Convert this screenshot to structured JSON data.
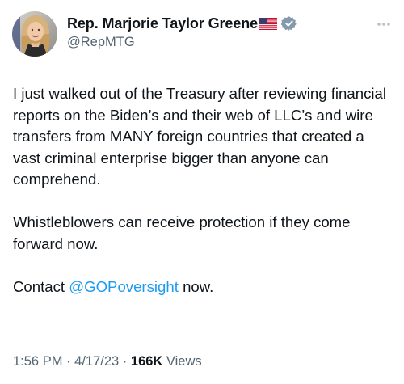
{
  "author": {
    "display_name": "Rep. Marjorie Taylor Greene",
    "handle": "@RepMTG",
    "flag_icon": "us-flag-icon",
    "verified_icon": "verified-badge-icon",
    "verified_color": "#829aab",
    "avatar": "profile-photo"
  },
  "more_icon": "more-options-icon",
  "tweet": {
    "paragraph1": "I just walked out of the Treasury after reviewing financial reports on the Biden’s and their web of LLC’s and wire transfers from MANY foreign countries that created a vast criminal enterprise bigger than anyone can comprehend.",
    "paragraph2": "Whistleblowers can receive protection if they come forward now.",
    "paragraph3_prefix": "Contact ",
    "mention": "@GOPoversight",
    "paragraph3_suffix": " now."
  },
  "meta": {
    "time": "1:56 PM",
    "separator": "·",
    "date": "4/17/23",
    "views_count": "166K",
    "views_label": " Views"
  },
  "colors": {
    "text": "#0f1419",
    "secondary": "#536471",
    "link": "#1d9bf0"
  }
}
